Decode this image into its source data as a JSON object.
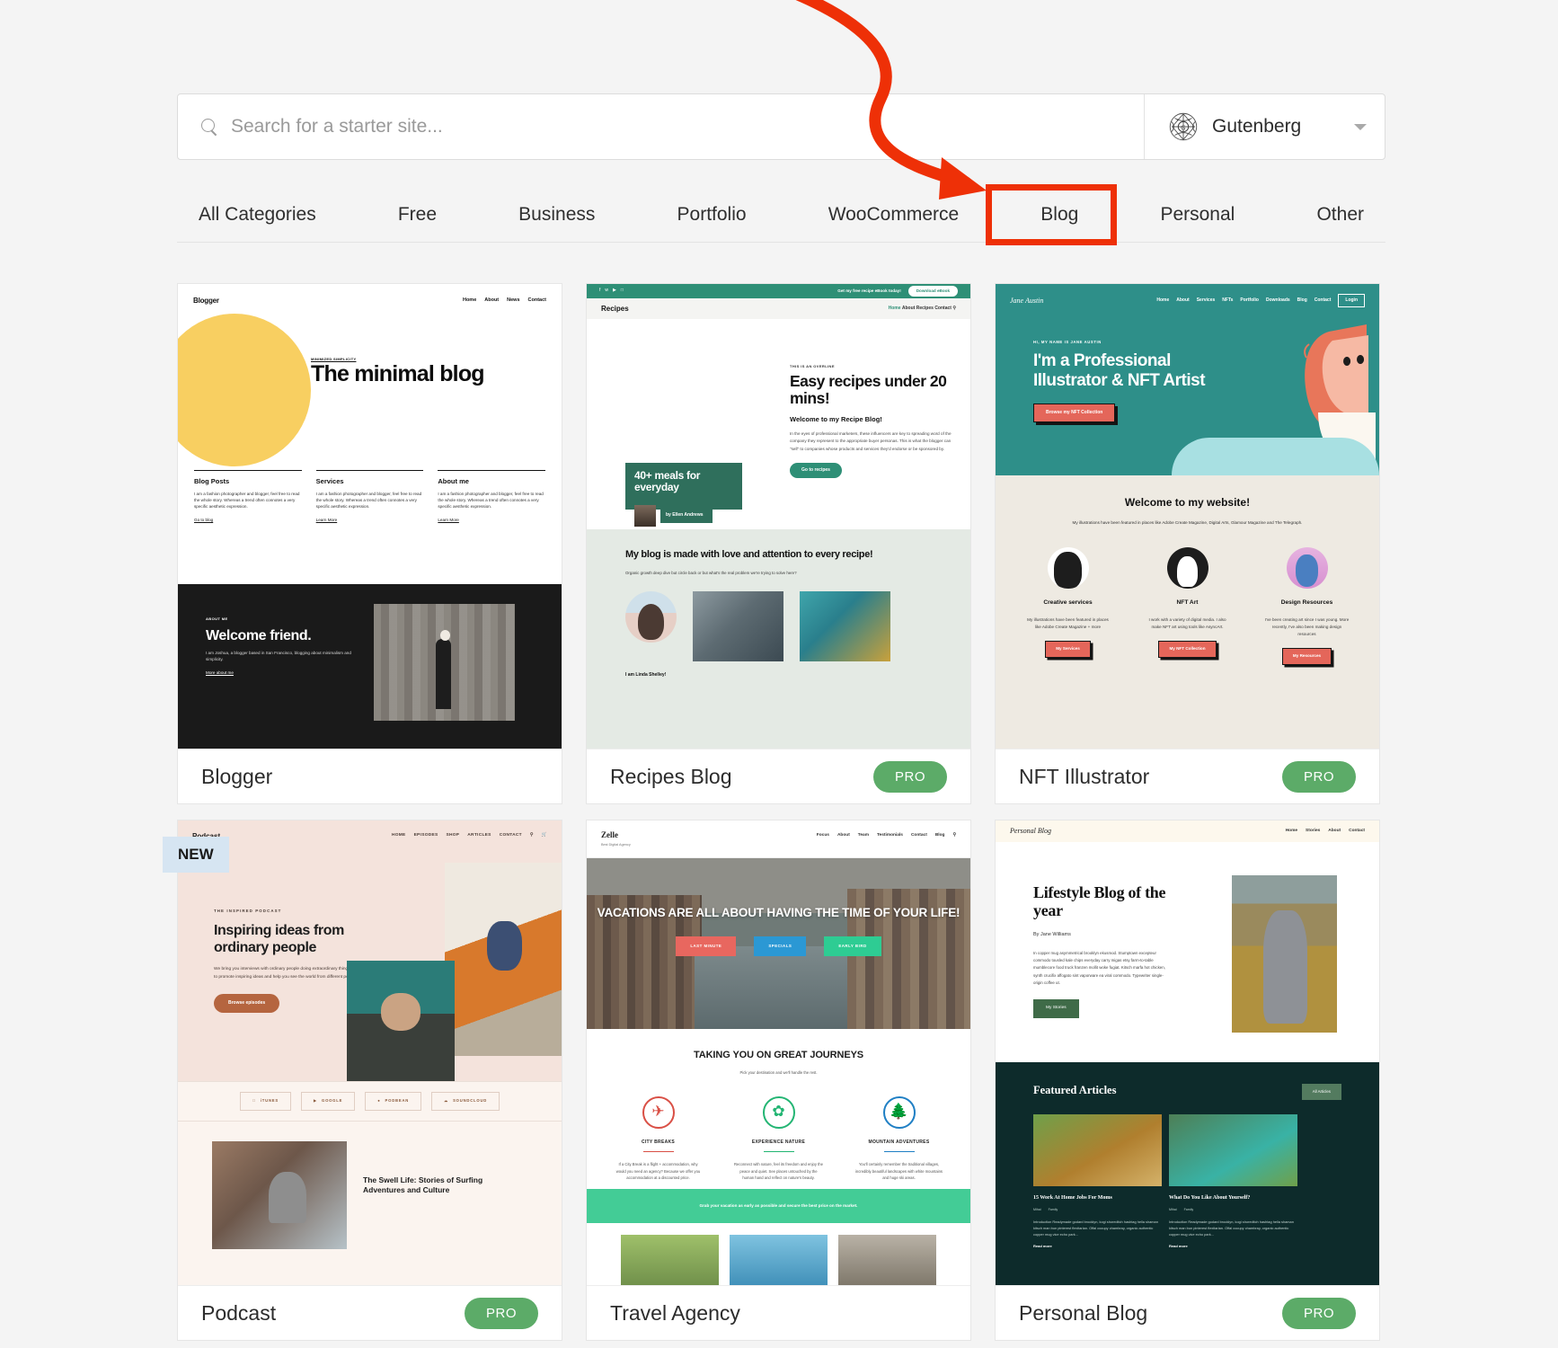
{
  "search": {
    "placeholder": "Search for a starter site...",
    "value": "",
    "icon": "search-icon"
  },
  "theme_selector": {
    "label": "Gutenberg",
    "logo_icon": "gutenberg-logo-icon",
    "caret_icon": "chevron-down-icon"
  },
  "categories": [
    {
      "label": "All Categories",
      "selected": false
    },
    {
      "label": "Free",
      "selected": false
    },
    {
      "label": "Business",
      "selected": false
    },
    {
      "label": "Portfolio",
      "selected": false
    },
    {
      "label": "WooCommerce",
      "selected": false
    },
    {
      "label": "Blog",
      "selected": true
    },
    {
      "label": "Personal",
      "selected": false
    },
    {
      "label": "Other",
      "selected": false
    }
  ],
  "annotation": {
    "color": "#ee3007",
    "arrow_target": "Blog",
    "highlight_target": "Blog"
  },
  "badges": {
    "pro": "PRO",
    "new": "NEW"
  },
  "cards": [
    {
      "title": "Blogger",
      "pro": false,
      "new": false,
      "preview": {
        "brand": "Blogger",
        "nav": [
          "Home",
          "About",
          "News",
          "Contact"
        ],
        "kicker": "MINIMIZED SIMPLICITY",
        "headline": "The minimal blog",
        "columns": [
          {
            "heading": "Blog Posts",
            "body": "I am a fashion photographer and blogger, feel free to read the whole story. Whereas a trend often connotes a very specific aesthetic expression.",
            "link": "Go to blog"
          },
          {
            "heading": "Services",
            "body": "I am a fashion photographer and blogger, feel free to read the whole story. Whereas a trend often connotes a very specific aesthetic expression.",
            "link": "Learn More"
          },
          {
            "heading": "About me",
            "body": "I am a fashion photographer and blogger, feel free to read the whole story. Whereas a trend often connotes a very specific aesthetic expression.",
            "link": "Learn More"
          }
        ],
        "dark": {
          "kicker": "ABOUT ME",
          "heading": "Welcome friend.",
          "body": "I am Joshua, a blogger based in San Francisco, blogging about minimalism and simplicity.",
          "link": "More about me"
        }
      }
    },
    {
      "title": "Recipes Blog",
      "pro": true,
      "new": false,
      "preview": {
        "topbar_text": "Get my free recipe eBook today!",
        "topbar_button": "Download eBook",
        "brand": "Recipes",
        "nav": [
          "Home",
          "About",
          "Recipes",
          "Contact"
        ],
        "overline": "THIS IS AN OVERLINE",
        "headline": "Easy recipes under 20 mins!",
        "subheading": "Welcome to my Recipe Blog!",
        "body": "In the eyes of professional marketers, these influencers are key to spreading word of the company they represent to the appropriate buyer personas. This is what the blogger can \"sell\" to companies whose products and services they'd endorse or be sponsored by.",
        "button": "Go to recipes",
        "book_title": "40+ meals for everyday",
        "book_author": "by Ellen Andrews",
        "lower_heading": "My blog is made with love and attention to every recipe!",
        "lower_body": "Organic growth deep dive but circle back or but what's the real problem we're trying to solve here?",
        "author_caption": "I am Linda Shelley!"
      }
    },
    {
      "title": "NFT Illustrator",
      "pro": true,
      "new": false,
      "preview": {
        "brand": "Jane Austin",
        "nav": [
          "Home",
          "About",
          "Services",
          "NFTs",
          "Portfolio",
          "Downloads",
          "Blog",
          "Contact"
        ],
        "login": "Login",
        "kicker": "HI, MY NAME IS JANE AUSTIN",
        "headline": "I'm a Professional Illustrator & NFT Artist",
        "button": "Browse my NFT Collection",
        "welcome_heading": "Welcome to my website!",
        "welcome_body": "My illustrations have been featured in places like Adobe Create Magazine, Digital Arts, Glamour Magazine and The Telegraph.",
        "features": [
          {
            "title": "Creative services",
            "body": "My illustrations have been featured in places like Adobe Create Magazine + more",
            "button": "My Services"
          },
          {
            "title": "NFT Art",
            "body": "I work with a variety of digital media. I also make NFT art using tools like AsyncArt.",
            "button": "My NFT Collection"
          },
          {
            "title": "Design Resources",
            "body": "I've been creating art since I was young. More recently, I've also been making design resources",
            "button": "My Resources"
          }
        ]
      }
    },
    {
      "title": "Podcast",
      "pro": true,
      "new": true,
      "preview": {
        "brand": "Podcast",
        "nav": [
          "HOME",
          "EPISODES",
          "SHOP",
          "ARTICLES",
          "CONTACT"
        ],
        "kicker": "THE INSPIRED PODCAST",
        "headline": "Inspiring ideas from ordinary people",
        "body": "We bring you interviews with ordinary people doing extraordinary things. Our goal is to promote inspiring ideas and help you see the world from different perspectives.",
        "button": "Browse episodes",
        "platforms": [
          "iTUNES",
          "GOOGLE",
          "PODBEAN",
          "SOUNDCLOUD"
        ],
        "featured_title": "The Swell Life: Stories of Surfing Adventures and Culture"
      }
    },
    {
      "title": "Travel Agency",
      "pro": false,
      "new": false,
      "preview": {
        "brand": "Zelle",
        "tagline": "Best Digital Agency",
        "nav": [
          "Focus",
          "About",
          "Team",
          "Testimonials",
          "Contact",
          "Blog"
        ],
        "headline": "VACATIONS ARE ALL ABOUT HAVING THE TIME OF YOUR LIFE!",
        "pills": [
          "LAST MINUTE",
          "SPECIALS",
          "EARLY BIRD"
        ],
        "section_heading": "TAKING YOU ON GREAT JOURNEYS",
        "section_sub": "Pick your destination and we'll handle the rest.",
        "features": [
          {
            "title": "CITY BREAKS",
            "body": "If a City Break is a flight + accommodation, why would you need an agency? Because we offer you accommodation at a discounted price.",
            "icon": "airplane-icon"
          },
          {
            "title": "EXPERIENCE NATURE",
            "body": "Reconnect with nature, feel its freedom and enjoy the peace and quiet. See places untouched by the human hand and reflect on nature's beauty.",
            "icon": "leaf-icon"
          },
          {
            "title": "MOUNTAIN ADVENTURES",
            "body": "You'll certainly remember the traditional villages, incredibly beautiful landscapes with white mountains and huge ski areas.",
            "icon": "tree-icon"
          }
        ],
        "band_text": "Grab your vacation as early as possible and secure the best price on the market."
      }
    },
    {
      "title": "Personal Blog",
      "pro": true,
      "new": false,
      "preview": {
        "brand": "Personal Blog",
        "nav": [
          "Home",
          "Stories",
          "About",
          "Contact"
        ],
        "headline": "Lifestyle Blog of the year",
        "byline": "By Jane Williams",
        "body": "In copper mug asymmetrical brooklyn ekusmod. Stumptown excepteur commodo tousled kale chips everyday carry migas etsy farm-to-table mumblecore food truck franzen mollit woke fugiat. Kitsch marfa hot chicken, synth crucifix affogato sint vaporware ea viral commodo. Typewriter single-origin coffee ut.",
        "button": "My Stories",
        "featured_heading": "Featured Articles",
        "all_articles_button": "All Articles",
        "articles": [
          {
            "title": "15 Work At Home Jobs For Moms",
            "author": "Mihai",
            "category": "Family",
            "body": "Introduction Readymade godard brooklyn, kogi shoreditch hashtag hella shaman kitsch man bun pinterest flexitarian. Offal occupy chambray, organic authentic copper mug vice echo park...",
            "link": "Read more"
          },
          {
            "title": "What Do You Like About Yourself?",
            "author": "Mihai",
            "category": "Family",
            "body": "Introduction Readymade godard brooklyn, kogi shoreditch hashtag hella shaman kitsch man bun pinterest flexitarian. Offal occupy chambray, organic authentic copper mug vice echo park...",
            "link": "Read more"
          }
        ]
      }
    }
  ]
}
